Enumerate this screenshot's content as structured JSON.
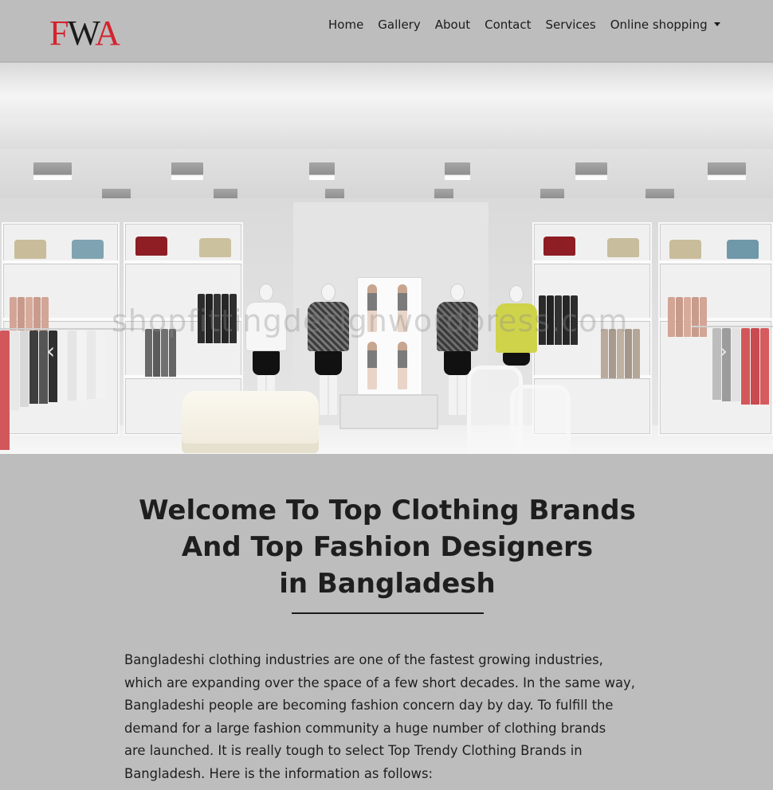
{
  "brand": {
    "logo_letters": [
      "F",
      "W",
      "A"
    ]
  },
  "nav": {
    "items": [
      {
        "label": "Home"
      },
      {
        "label": "Gallery"
      },
      {
        "label": "About"
      },
      {
        "label": "Contact"
      },
      {
        "label": "Services"
      },
      {
        "label": "Online shopping",
        "has_dropdown": true
      }
    ]
  },
  "hero": {
    "watermark": "shopfittingdesignwordpress.com",
    "prev_icon": "chevron-left-icon",
    "next_icon": "chevron-right-icon"
  },
  "main": {
    "heading_lines": [
      "Welcome To Top Clothing Brands",
      "And Top Fashion Designers",
      "in Bangladesh"
    ],
    "body_lines": [
      "Bangladeshi clothing industries are one of the fastest growing industries,",
      "which are expanding over the space of a few short decades. In the same way,",
      "Bangladeshi people are becoming fashion concern day by day. To fulfill the",
      "demand for a large fashion community a huge number of clothing brands",
      "are launched. It is really tough to select Top Trendy Clothing Brands in",
      "Bangladesh. Here is the information as follows:"
    ]
  },
  "colors": {
    "page_bg": "#bdbdbd",
    "logo_red": "#d4232e",
    "text": "#1e1e1e"
  }
}
